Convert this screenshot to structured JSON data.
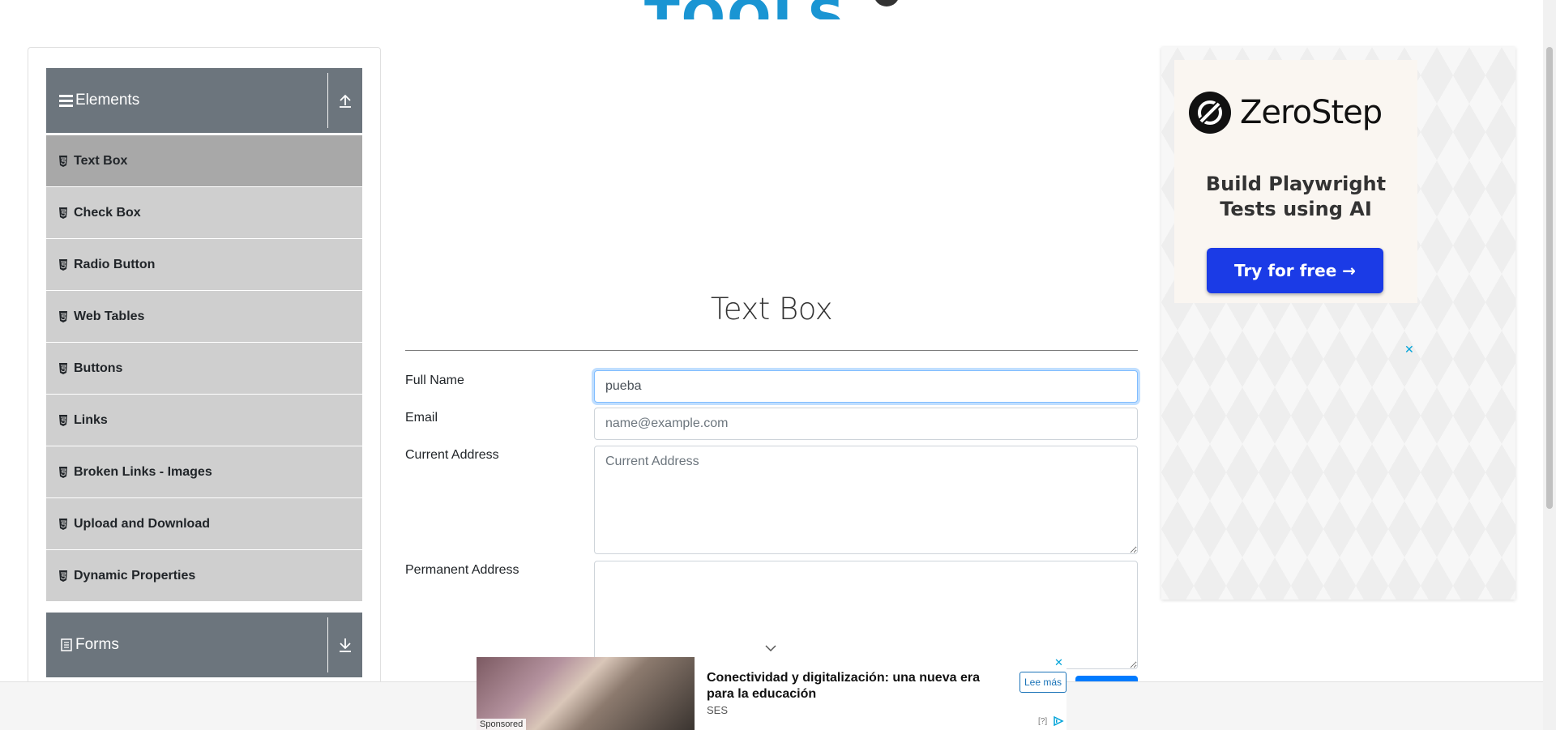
{
  "sidebar": {
    "elements_group": {
      "title": "Elements",
      "icon": "hamburger-icon",
      "toggle_icon": "collapse-up-icon"
    },
    "items": [
      {
        "label": "Text Box",
        "active": true
      },
      {
        "label": "Check Box",
        "active": false
      },
      {
        "label": "Radio Button",
        "active": false
      },
      {
        "label": "Web Tables",
        "active": false
      },
      {
        "label": "Buttons",
        "active": false
      },
      {
        "label": "Links",
        "active": false
      },
      {
        "label": "Broken Links - Images",
        "active": false
      },
      {
        "label": "Upload and Download",
        "active": false
      },
      {
        "label": "Dynamic Properties",
        "active": false
      }
    ],
    "forms_group": {
      "title": "Forms",
      "icon": "document-icon",
      "toggle_icon": "expand-down-icon"
    }
  },
  "main": {
    "title": "Text Box",
    "fields": {
      "full_name": {
        "label": "Full Name",
        "value": "pueba",
        "placeholder": "Full Name"
      },
      "email": {
        "label": "Email",
        "value": "",
        "placeholder": "name@example.com"
      },
      "current_address": {
        "label": "Current Address",
        "value": "",
        "placeholder": "Current Address"
      },
      "permanent_address": {
        "label": "Permanent Address",
        "value": "",
        "placeholder": ""
      }
    }
  },
  "ad_right": {
    "brand": "ZeroStep",
    "headline_line1": "Build Playwright",
    "headline_line2": "Tests using AI",
    "cta": "Try for free →",
    "close": "✕"
  },
  "ad_bottom": {
    "title": "Conectividad y digitalización: una nueva era para la educación",
    "advertiser": "SES",
    "cta": "Lee más",
    "sponsored": "Sponsored",
    "info": "[?]",
    "close": "✕"
  },
  "colors": {
    "sidebar_header": "#6c757d",
    "menu_item": "#cfcfcf",
    "menu_item_active": "#a8a8a8",
    "logo_blue": "#1a95d3",
    "ad_cta": "#1b3be6",
    "focus_border": "#80bdff"
  }
}
